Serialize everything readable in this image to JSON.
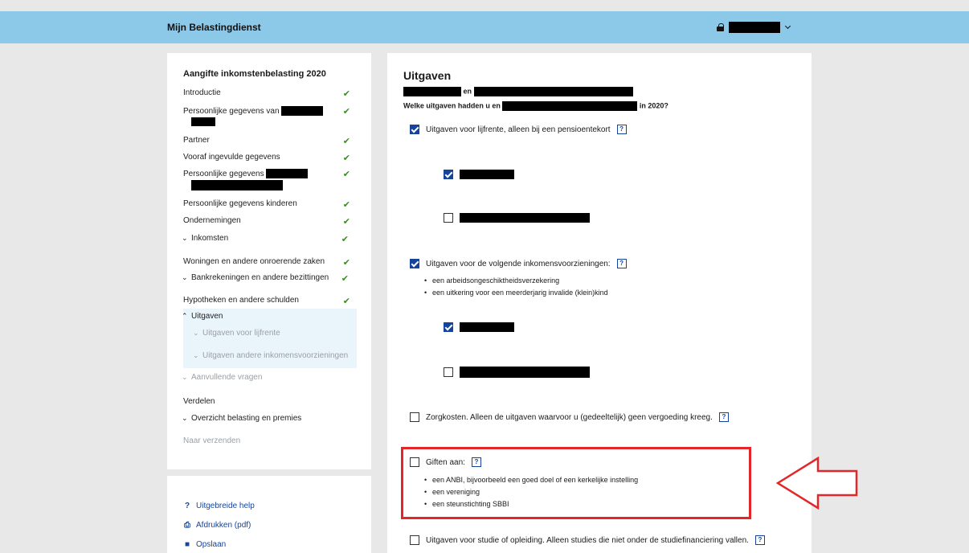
{
  "header": {
    "brand": "Mijn Belastingdienst",
    "icon": "lock-icon"
  },
  "nav": {
    "title": "Aangifte inkomstenbelasting 2020",
    "items": [
      {
        "label": "Introductie",
        "done": true
      },
      {
        "label": "Persoonlijke gegevens van",
        "done": true
      },
      {
        "label": "Partner",
        "done": true
      },
      {
        "label": "Vooraf ingevulde gegevens",
        "done": true
      },
      {
        "label": "Persoonlijke gegevens",
        "done": true
      },
      {
        "label": "Persoonlijke gegevens kinderen",
        "done": true
      },
      {
        "label": "Ondernemingen",
        "done": true
      },
      {
        "label": "Inkomsten",
        "done": true
      },
      {
        "label": "Woningen en andere onroerende zaken",
        "done": true
      },
      {
        "label": "Bankrekeningen en andere bezittingen",
        "done": true
      },
      {
        "label": "Hypotheken en andere schulden",
        "done": true
      },
      {
        "label": "Uitgaven"
      },
      {
        "label": "Uitgaven voor lijfrente"
      },
      {
        "label": "Uitgaven andere inkomensvoorzieningen"
      },
      {
        "label": "Aanvullende vragen"
      },
      {
        "label": "Verdelen"
      },
      {
        "label": "Overzicht belasting en premies"
      },
      {
        "label": "Naar verzenden"
      }
    ],
    "check_glyph": "✔",
    "check_color": "#3a8f1e"
  },
  "help": {
    "items": [
      {
        "label": "Uitgebreide help",
        "icon": "question-icon"
      },
      {
        "label": "Afdrukken (pdf)",
        "icon": "print-icon"
      },
      {
        "label": "Opslaan",
        "icon": "save-icon"
      }
    ]
  },
  "main": {
    "title": "Uitgaven",
    "subtitle_en": "en",
    "question_prefix": "Welke uitgaven hadden u en",
    "question_suffix": "in 2020?",
    "q_lijfrente": "Uitgaven voor lijfrente, alleen bij een pensioentekort",
    "q_inkomen": "Uitgaven voor de volgende inkomensvoorzieningen:",
    "inkomen_bullets": [
      "een arbeidsongeschiktheidsverzekering",
      "een uitkering voor een meerderjarig invalide (klein)kind"
    ],
    "q_zorg": "Zorgkosten. Alleen de uitgaven waarvoor u (gedeeltelijk) geen vergoeding kreeg.",
    "q_giften": "Giften aan:",
    "giften_bullets": [
      "een ANBI, bijvoorbeeld een goed doel of een kerkelijke instelling",
      "een vereniging",
      "een steunstichting SBBI"
    ],
    "q_studie": "Uitgaven voor studie of opleiding. Alleen studies die niet onder de studiefinanciering vallen.",
    "help_mark": "?"
  },
  "colors": {
    "header": "#8cc8e8",
    "accent": "#15439e",
    "highlight": "#e3262a"
  }
}
